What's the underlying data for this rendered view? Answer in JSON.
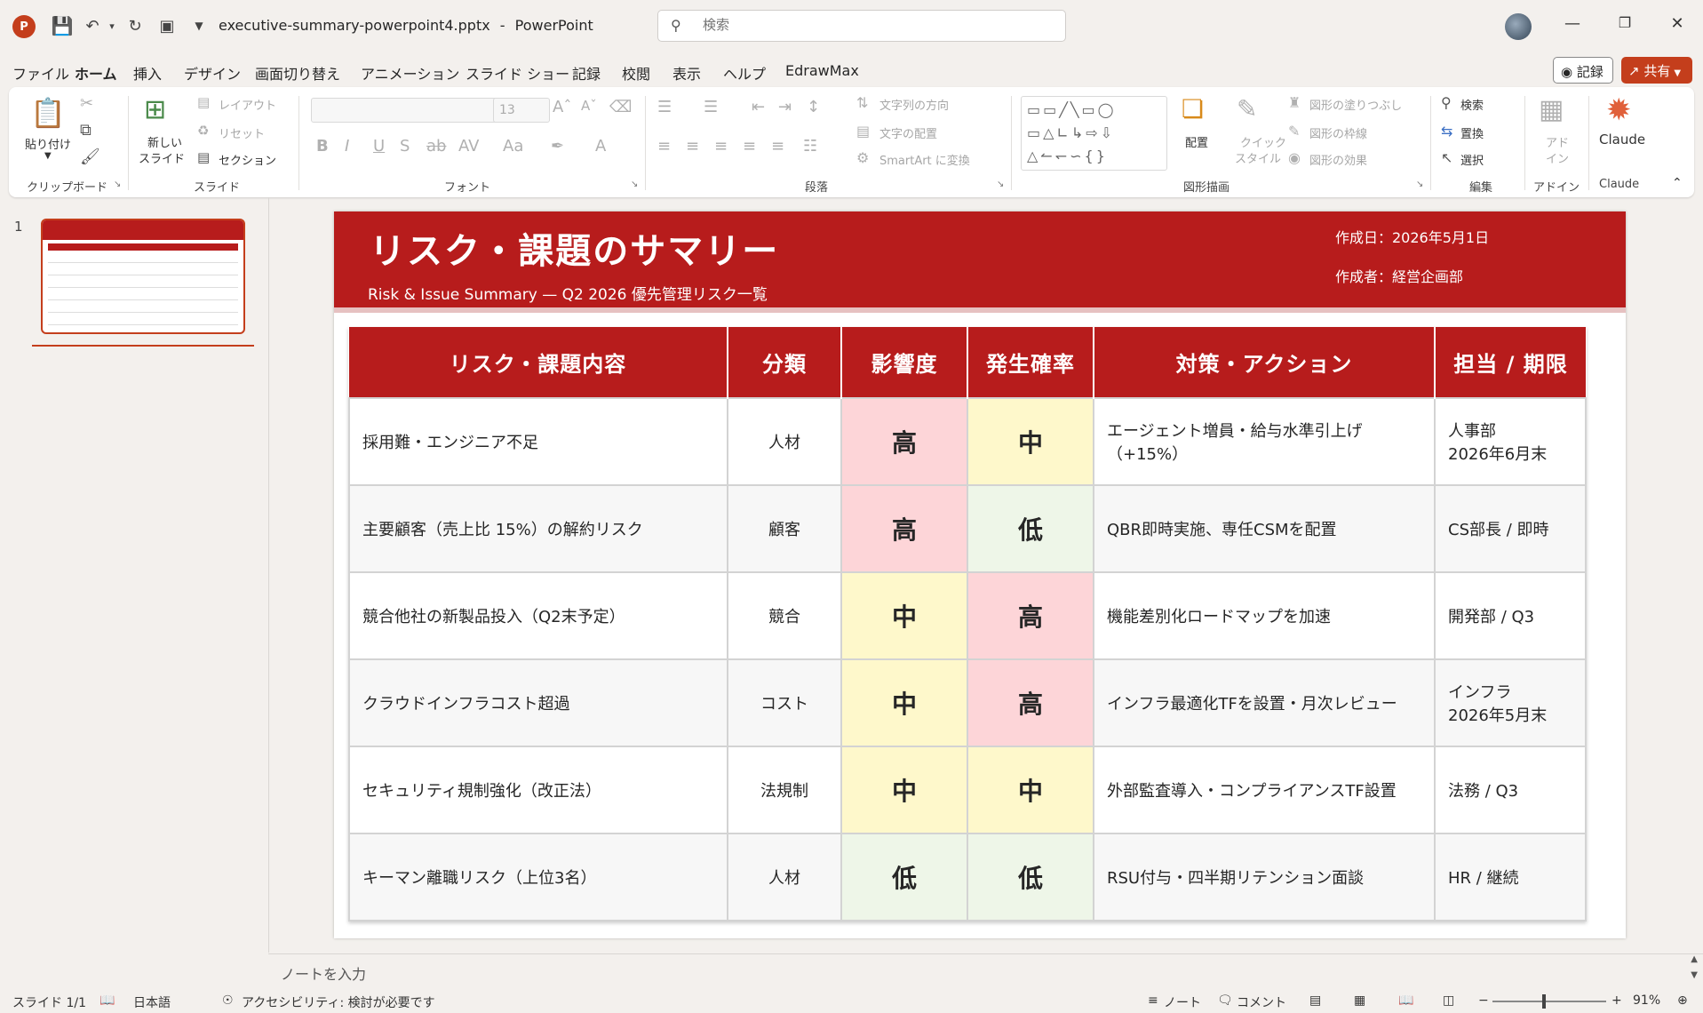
{
  "app": {
    "file_name": "executive-summary-powerpoint4.pptx",
    "app_name": "PowerPoint",
    "title_sep": "-",
    "search_placeholder": "検索"
  },
  "menu": {
    "tabs": [
      "ファイル",
      "ホーム",
      "挿入",
      "デザイン",
      "画面切り替え",
      "アニメーション",
      "スライド ショー",
      "記録",
      "校閲",
      "表示",
      "ヘルプ",
      "EdrawMax"
    ],
    "active_tab": "ホーム",
    "record_label": "記録",
    "share_label": "共有"
  },
  "ribbon": {
    "clipboard": {
      "paste": "貼り付け",
      "label": "クリップボード"
    },
    "slides": {
      "new_slide_1": "新しい",
      "new_slide_2": "スライド",
      "layout": "レイアウト",
      "reset": "リセット",
      "section": "セクション",
      "label": "スライド"
    },
    "font": {
      "size": "13",
      "label": "フォント"
    },
    "paragraph": {
      "text_direction": "文字列の方向",
      "align_text": "文字の配置",
      "smartart": "SmartArt に変換",
      "label": "段落"
    },
    "drawing": {
      "arrange": "配置",
      "quick_style_1": "クイック",
      "quick_style_2": "スタイル",
      "shape_fill": "図形の塗りつぶし",
      "shape_outline": "図形の枠線",
      "shape_effects": "図形の効果",
      "label": "図形描画"
    },
    "editing": {
      "find": "検索",
      "replace": "置換",
      "select": "選択",
      "label": "編集"
    },
    "addins": {
      "addin_1": "アド",
      "addin_2": "イン",
      "label": "アドイン"
    },
    "claude": {
      "button": "Claude",
      "label": "Claude"
    }
  },
  "slide_panel": {
    "slide_number": "1"
  },
  "slide": {
    "title": "リスク・課題のサマリー",
    "subtitle": "Risk & Issue Summary — Q2 2026 優先管理リスク一覧",
    "date": "作成日：2026年5月1日",
    "author": "作成者：経営企画部",
    "table": {
      "headers": [
        "リスク・課題内容",
        "分類",
        "影響度",
        "発生確率",
        "対策・アクション",
        "担当 / 期限"
      ],
      "rows": [
        {
          "item": "採用難・エンジニア不足",
          "category": "人材",
          "impact": "高",
          "probability": "中",
          "action_1": "エージェント増員・給与水準引上げ",
          "action_2": "（+15%）",
          "owner_1": "人事部",
          "owner_2": "2026年6月末"
        },
        {
          "item": "主要顧客（売上比 15%）の解約リスク",
          "category": "顧客",
          "impact": "高",
          "probability": "低",
          "action_1": "QBR即時実施、専任CSMを配置",
          "action_2": "",
          "owner_1": "CS部長 / 即時",
          "owner_2": ""
        },
        {
          "item": "競合他社の新製品投入（Q2末予定）",
          "category": "競合",
          "impact": "中",
          "probability": "高",
          "action_1": "機能差別化ロードマップを加速",
          "action_2": "",
          "owner_1": "開発部 / Q3",
          "owner_2": ""
        },
        {
          "item": "クラウドインフラコスト超過",
          "category": "コスト",
          "impact": "中",
          "probability": "高",
          "action_1": "インフラ最適化TFを設置・月次レビュー",
          "action_2": "",
          "owner_1": "インフラ",
          "owner_2": "2026年5月末"
        },
        {
          "item": "セキュリティ規制強化（改正法）",
          "category": "法規制",
          "impact": "中",
          "probability": "中",
          "action_1": "外部監査導入・コンプライアンスTF設置",
          "action_2": "",
          "owner_1": "法務 / Q3",
          "owner_2": ""
        },
        {
          "item": "キーマン離職リスク（上位3名）",
          "category": "人材",
          "impact": "低",
          "probability": "低",
          "action_1": "RSU付与・四半期リテンション面談",
          "action_2": "",
          "owner_1": "HR / 継続",
          "owner_2": ""
        }
      ]
    }
  },
  "notes": {
    "placeholder": "ノートを入力"
  },
  "status": {
    "slide_count": "スライド 1/1",
    "language": "日本語",
    "accessibility": "アクセシビリティ: 検討が必要です",
    "notes_button": "ノート",
    "comments_button": "コメント",
    "zoom": "91%"
  },
  "colors": {
    "accent": "#c43e1c",
    "header_red": "#b71c1c",
    "high": "#fdd5d8",
    "mid": "#fef8cb",
    "low": "#eef6e8"
  }
}
